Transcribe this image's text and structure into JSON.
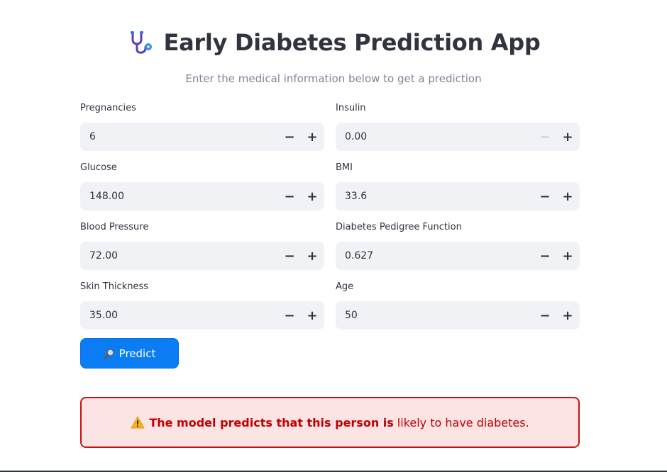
{
  "header": {
    "title": "Early Diabetes Prediction App",
    "title_icon": "stethoscope-icon",
    "subtitle": "Enter the medical information below to get a prediction"
  },
  "form": {
    "fields": [
      {
        "label": "Pregnancies",
        "value": "6"
      },
      {
        "label": "Glucose",
        "value": "148.00"
      },
      {
        "label": "Blood Pressure",
        "value": "72.00"
      },
      {
        "label": "Skin Thickness",
        "value": "35.00"
      },
      {
        "label": "Insulin",
        "value": "0.00"
      },
      {
        "label": "BMI",
        "value": "33.6"
      },
      {
        "label": "Diabetes Pedigree Function",
        "value": "0.627"
      },
      {
        "label": "Age",
        "value": "50"
      }
    ],
    "minus_symbol": "−",
    "plus_symbol": "+"
  },
  "predict_button": {
    "label": "Predict",
    "icon": "magnifying-glass-icon",
    "color": "#0a7df5"
  },
  "result": {
    "icon": "warning-icon",
    "bold_text": "The model predicts that this person is",
    "normal_text": "likely to have diabetes.",
    "border_color": "#cc1111",
    "background_color": "#fde4e4",
    "text_color": "#c00000"
  }
}
